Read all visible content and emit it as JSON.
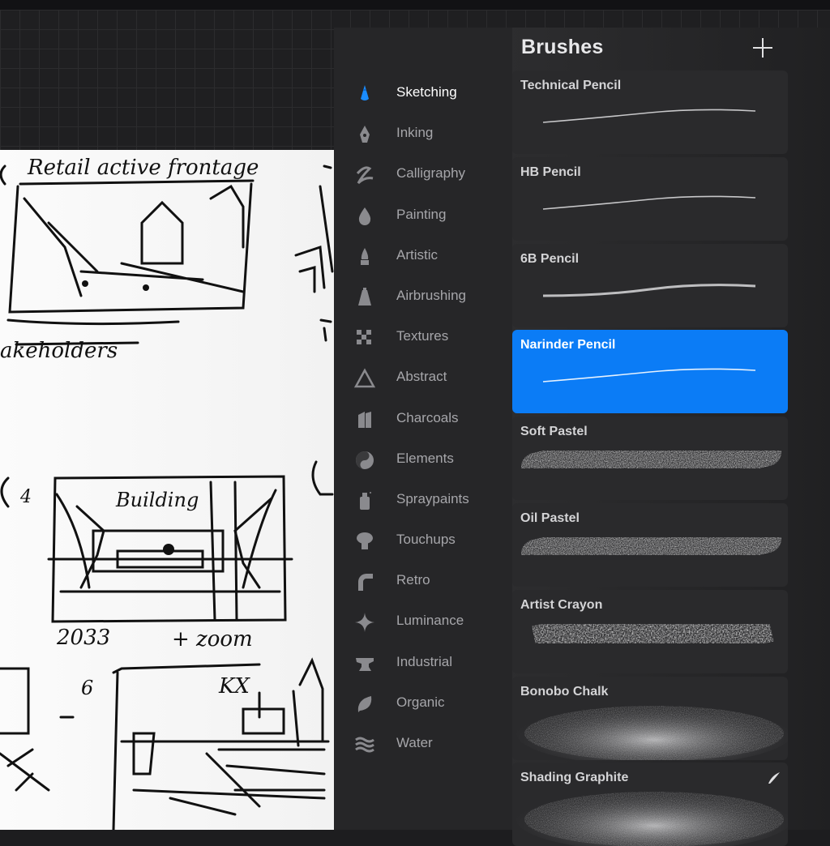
{
  "panel": {
    "title": "Brushes",
    "add_button_label": "+"
  },
  "categories": [
    {
      "label": "Sketching",
      "icon": "pencil-tip-icon",
      "active": true
    },
    {
      "label": "Inking",
      "icon": "pen-nib-icon"
    },
    {
      "label": "Calligraphy",
      "icon": "calligraphy-stroke-icon"
    },
    {
      "label": "Painting",
      "icon": "paint-drop-icon"
    },
    {
      "label": "Artistic",
      "icon": "brush-tip-icon"
    },
    {
      "label": "Airbrushing",
      "icon": "airbrush-icon"
    },
    {
      "label": "Textures",
      "icon": "checker-texture-icon"
    },
    {
      "label": "Abstract",
      "icon": "triangle-icon"
    },
    {
      "label": "Charcoals",
      "icon": "charcoal-stick-icon"
    },
    {
      "label": "Elements",
      "icon": "yin-yang-icon"
    },
    {
      "label": "Spraypaints",
      "icon": "spray-can-icon"
    },
    {
      "label": "Touchups",
      "icon": "touchup-brush-icon"
    },
    {
      "label": "Retro",
      "icon": "retro-arc-icon"
    },
    {
      "label": "Luminance",
      "icon": "sparkle-icon"
    },
    {
      "label": "Industrial",
      "icon": "anvil-icon"
    },
    {
      "label": "Organic",
      "icon": "leaf-icon"
    },
    {
      "label": "Water",
      "icon": "waves-icon"
    }
  ],
  "brushes": [
    {
      "name": "Technical Pencil",
      "stroke": "thin"
    },
    {
      "name": "HB Pencil",
      "stroke": "thin"
    },
    {
      "name": "6B Pencil",
      "stroke": "medium"
    },
    {
      "name": "Narinder Pencil",
      "stroke": "thin",
      "selected": true
    },
    {
      "name": "Soft Pastel",
      "stroke": "pastel"
    },
    {
      "name": "Oil Pastel",
      "stroke": "pastel"
    },
    {
      "name": "Artist Crayon",
      "stroke": "crayon"
    },
    {
      "name": "Bonobo Chalk",
      "stroke": "chalk"
    },
    {
      "name": "Shading Graphite",
      "stroke": "chalk",
      "imported": true
    }
  ],
  "sketch": {
    "labels": [
      "Retail active frontage",
      "akeholders",
      "Building",
      "2033",
      "+ zoom",
      "KX",
      "4",
      "6"
    ]
  },
  "colors": {
    "accent": "#0b7cf6",
    "panel": "#262628",
    "active_icon": "#1a8cff"
  }
}
